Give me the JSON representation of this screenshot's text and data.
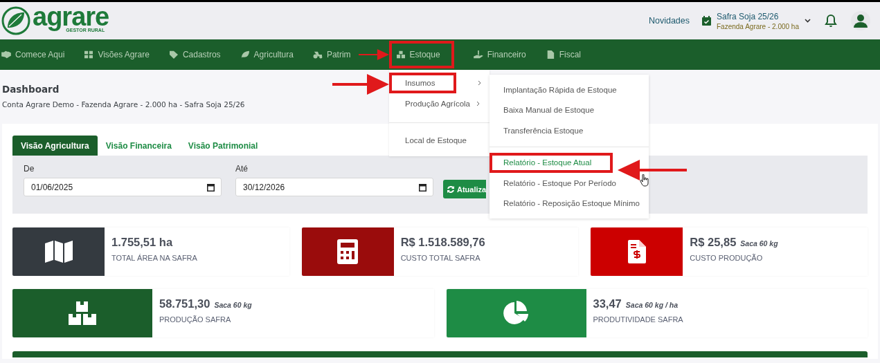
{
  "header": {
    "logo_text": "agrare",
    "logo_subtext": "GESTOR RURAL",
    "news_link": "Novidades",
    "season": {
      "title": "Safra Soja 25/26",
      "farm": "Fazenda Agrare - 2.000 ha"
    }
  },
  "nav": [
    {
      "label": "Comece Aqui",
      "highlighted": false
    },
    {
      "label": "Visões Agrare",
      "highlighted": false
    },
    {
      "label": "Cadastros",
      "highlighted": false
    },
    {
      "label": "Agricultura",
      "highlighted": false
    },
    {
      "label": "Patrim",
      "highlighted": false
    },
    {
      "label": "Estoque",
      "highlighted": true
    },
    {
      "label": "Financeiro",
      "highlighted": false
    },
    {
      "label": "Fiscal",
      "highlighted": false
    }
  ],
  "page": {
    "title": "Dashboard",
    "subtitle": "Conta Agrare Demo - Fazenda Agrare - 2.000 ha - Safra Soja 25/26"
  },
  "tabs": [
    {
      "label": "Visão Agricultura",
      "selected": true
    },
    {
      "label": "Visão Financeira",
      "selected": false
    },
    {
      "label": "Visão Patrimonial",
      "selected": false
    }
  ],
  "filters": {
    "from": {
      "label": "De",
      "value": "01/06/2025"
    },
    "to": {
      "label": "Até",
      "value": "30/12/2026"
    },
    "refresh_button": "Atualiza"
  },
  "stats": [
    {
      "value": "1.755,51 ha",
      "label": "TOTAL ÁREA NA SAFRA",
      "color": "#343a40"
    },
    {
      "value": "R$ 1.518.589,76",
      "label": "CUSTO TOTAL SAFRA",
      "color": "#9a0c0c"
    },
    {
      "value": "R$ 25,85",
      "unit": "Saca 60 kg",
      "label": "CUSTO PRODUÇÃO",
      "color": "#cc0000"
    },
    {
      "value": "58.751,30",
      "unit": "Saca 60 kg",
      "label": "PRODUÇÃO SAFRA",
      "color": "#1b5e2b"
    },
    {
      "value": "33,47",
      "unit": "Saca 60 kg / ha",
      "label": "PRODUTIVIDADE SAFRA",
      "color": "#1e8c45"
    }
  ],
  "menu": [
    {
      "label": "Insumos",
      "has_submenu": true,
      "highlighted": true
    },
    {
      "label": "Produção Agrícola",
      "has_submenu": true,
      "highlighted": false
    },
    {
      "label": "Local de Estoque",
      "has_submenu": false,
      "highlighted": false
    }
  ],
  "submenu": [
    {
      "label": "Implantação Rápida de Estoque",
      "highlighted": false,
      "selected": false
    },
    {
      "label": "Baixa Manual de Estoque",
      "highlighted": false,
      "selected": false
    },
    {
      "label": "Transferência Estoque",
      "highlighted": false,
      "selected": false
    },
    {
      "label": "Relatório - Estoque Atual",
      "highlighted": true,
      "selected": true
    },
    {
      "label": "Relatório - Estoque Por Período",
      "highlighted": false,
      "selected": false
    },
    {
      "label": "Relatório - Reposição Estoque Mínimo",
      "highlighted": false,
      "selected": false
    }
  ]
}
